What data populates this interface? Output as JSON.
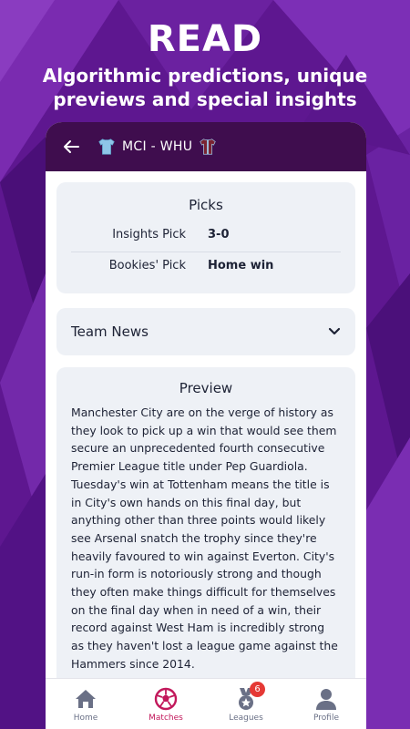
{
  "promo": {
    "title": "READ",
    "subtitle": "Algorithmic predictions, unique previews and special insights"
  },
  "header": {
    "back_icon": "arrow-left-icon",
    "match": "MCI - WHU",
    "home_kit_color": "#8ec5e8",
    "away_kit_color": "#7a2331"
  },
  "picks": {
    "heading": "Picks",
    "rows": [
      {
        "label": "Insights Pick",
        "value": "3-0"
      },
      {
        "label": "Bookies' Pick",
        "value": "Home win"
      }
    ]
  },
  "team_news": {
    "label": "Team News",
    "icon": "chevron-down-icon"
  },
  "preview": {
    "heading": "Preview",
    "text": "Manchester City are on the verge of history as they look to pick up a win that would see them secure an unprecedented fourth consecutive Premier League title under Pep Guardiola. Tuesday's win at Tottenham means the title is in City's own hands on this final day, but anything other than three points would likely see Arsenal snatch the trophy since they're heavily favoured to win against Everton. City's run-in form is notoriously strong and though they often make things difficult for themselves on the final day when in need of a win, their record against West Ham is incredibly strong as they haven't lost a league game against the Hammers since 2014."
  },
  "nav": {
    "items": [
      {
        "label": "Home",
        "icon": "home-icon"
      },
      {
        "label": "Matches",
        "icon": "football-icon",
        "active": true
      },
      {
        "label": "Leagues",
        "icon": "medal-icon",
        "badge": "6"
      },
      {
        "label": "Profile",
        "icon": "person-icon"
      }
    ]
  },
  "colors": {
    "background": "#6a1a9a",
    "header": "#3f0d4e",
    "active_tab": "#c2185b",
    "badge": "#e53935"
  }
}
